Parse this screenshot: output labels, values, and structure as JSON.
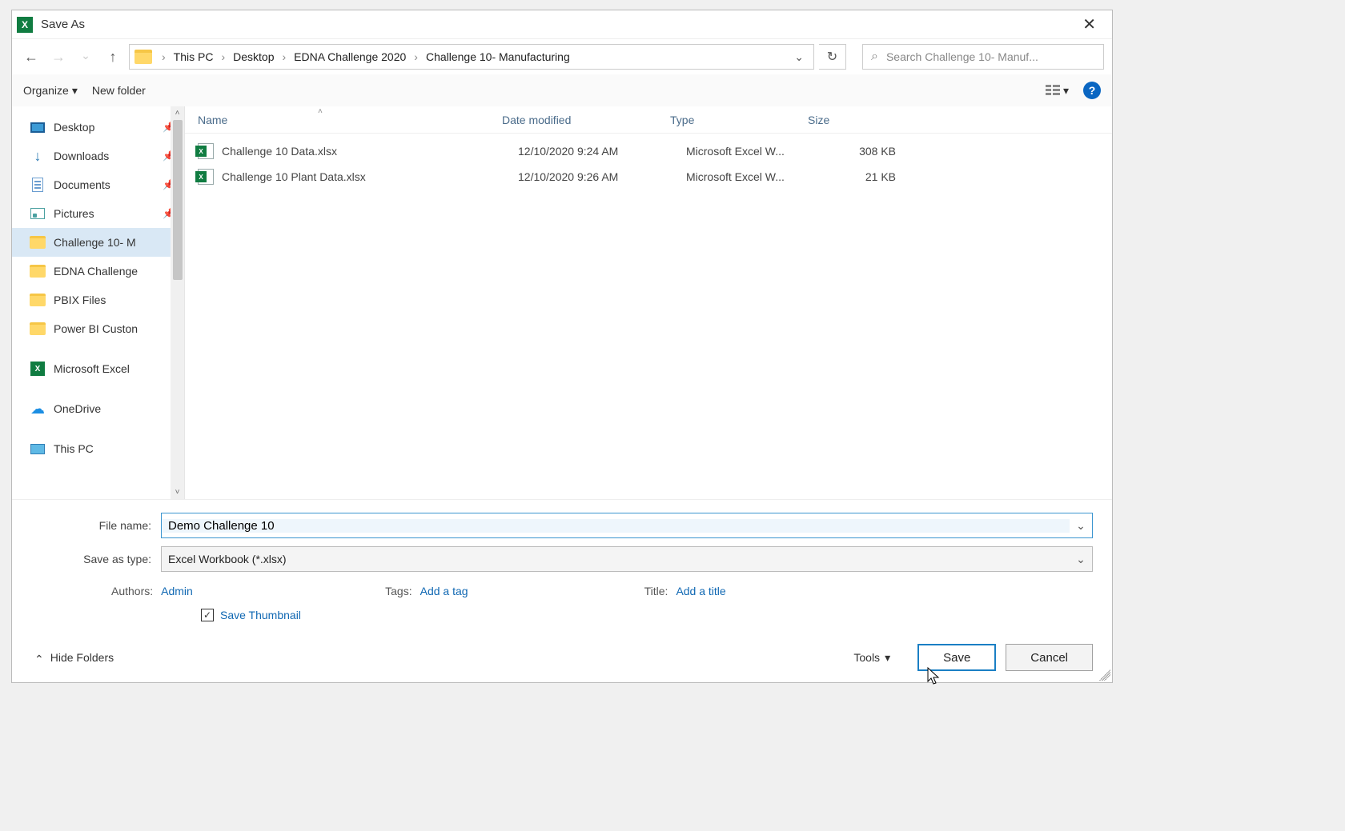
{
  "dialog": {
    "title": "Save As"
  },
  "nav": {
    "breadcrumb": [
      "This PC",
      "Desktop",
      "EDNA Challenge 2020",
      "Challenge 10- Manufacturing"
    ],
    "search_placeholder": "Search Challenge 10- Manuf..."
  },
  "toolbar": {
    "organize": "Organize",
    "new_folder": "New folder"
  },
  "tree": {
    "items": [
      {
        "icon": "desktop",
        "label": "Desktop",
        "pinned": true
      },
      {
        "icon": "download",
        "label": "Downloads",
        "pinned": true
      },
      {
        "icon": "doc",
        "label": "Documents",
        "pinned": true
      },
      {
        "icon": "pic",
        "label": "Pictures",
        "pinned": true
      },
      {
        "icon": "folder",
        "label": "Challenge 10- M",
        "selected": true
      },
      {
        "icon": "folder",
        "label": "EDNA Challenge"
      },
      {
        "icon": "folder",
        "label": "PBIX Files"
      },
      {
        "icon": "folder",
        "label": "Power BI Custon"
      },
      {
        "icon": "excel",
        "label": "Microsoft Excel",
        "spaced": true
      },
      {
        "icon": "onedrive",
        "label": "OneDrive",
        "spaced": true
      },
      {
        "icon": "pc",
        "label": "This PC",
        "spaced": true
      }
    ]
  },
  "columns": {
    "name": "Name",
    "date": "Date modified",
    "type": "Type",
    "size": "Size"
  },
  "files": [
    {
      "name": "Challenge 10 Data.xlsx",
      "date": "12/10/2020 9:24 AM",
      "type": "Microsoft Excel W...",
      "size": "308 KB"
    },
    {
      "name": "Challenge 10 Plant Data.xlsx",
      "date": "12/10/2020 9:26 AM",
      "type": "Microsoft Excel W...",
      "size": "21 KB"
    }
  ],
  "form": {
    "filename_label": "File name:",
    "filename_value": "Demo Challenge 10",
    "savetype_label": "Save as type:",
    "savetype_value": "Excel Workbook (*.xlsx)",
    "authors_label": "Authors:",
    "authors_value": "Admin",
    "tags_label": "Tags:",
    "tags_value": "Add a tag",
    "title_label": "Title:",
    "title_value": "Add a title",
    "thumbnail_label": "Save Thumbnail"
  },
  "bottom": {
    "hide_folders": "Hide Folders",
    "tools": "Tools",
    "save": "Save",
    "cancel": "Cancel"
  }
}
